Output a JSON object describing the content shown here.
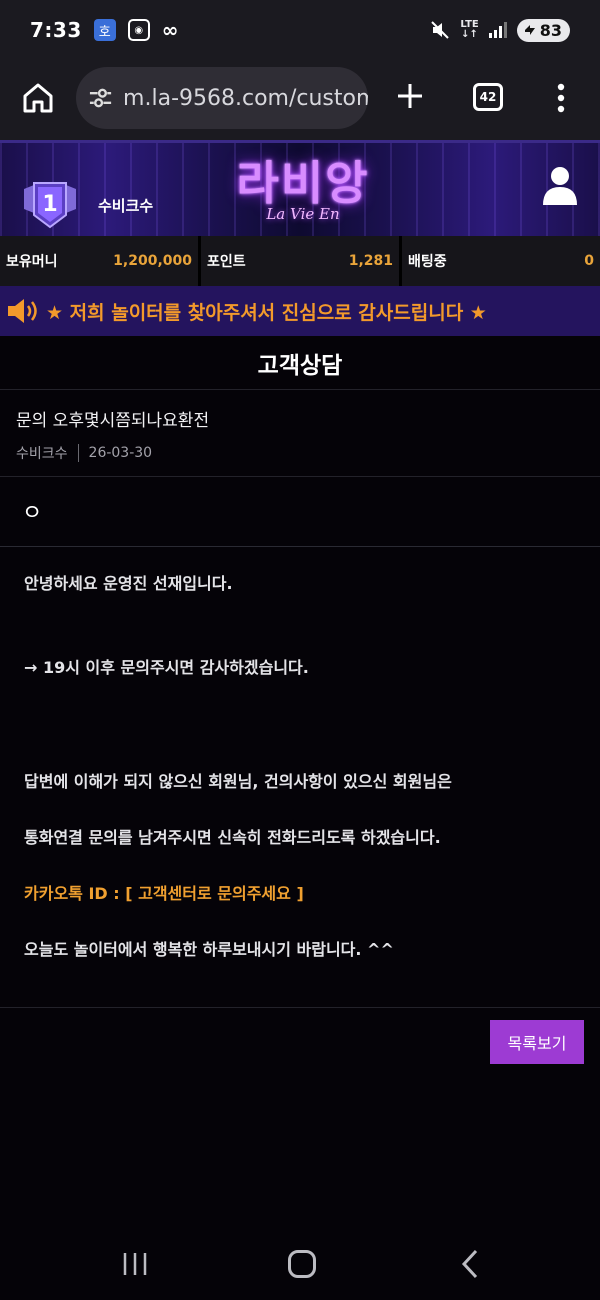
{
  "status_bar": {
    "time": "7:33",
    "app_icon_text": "호",
    "lte_label": "LTE",
    "battery_level": "83"
  },
  "browser": {
    "url": "m.la-9568.com/custom",
    "tab_count": "42"
  },
  "banner": {
    "rank_number": "1",
    "username": "수비크수",
    "logo_text": "라비앙",
    "logo_subtext": "La Vie En"
  },
  "stats": [
    {
      "label": "보유머니",
      "value": "1,200,000"
    },
    {
      "label": "포인트",
      "value": "1,281"
    },
    {
      "label": "배팅중",
      "value": "0"
    }
  ],
  "notice": {
    "text": "★ 저희 놀이터를 찾아주셔서 진심으로 감사드립니다 ★"
  },
  "page": {
    "title": "고객상담"
  },
  "post": {
    "title": "문의 오후몇시쯤되나요환전",
    "author": "수비크수",
    "date": "26-03-30",
    "question_body": "ㅇ"
  },
  "answer": {
    "lines": [
      "안녕하세요 운영진 선재입니다.",
      "→ 19시 이후 문의주시면 감사하겠습니다.",
      "답변에 이해가 되지 않으신 회원님, 건의사항이 있으신 회원님은",
      "통화연결 문의를 남겨주시면 신속히 전화드리도록 하겠습니다.",
      "카카오톡 ID : [ 고객센터로 문의주세요 ]",
      "오늘도 놀이터에서 행복한 하루보내시기 바랍니다. ^^"
    ]
  },
  "actions": {
    "list_button_label": "목록보기"
  },
  "colors": {
    "accent_orange": "#f0a030",
    "button_purple": "#9d3bd3",
    "notice_bg": "#24145e",
    "logo_neon": "#d88cff"
  },
  "icons": {
    "home": "home-icon",
    "site_settings": "tune-icon",
    "new_tab": "plus-icon",
    "tabs": "tab-switcher-icon",
    "menu": "more-vert-icon",
    "profile": "person-icon",
    "notice": "speaker-icon",
    "nav_recents": "recents-icon",
    "nav_home": "home-circle-icon",
    "nav_back": "back-chevron-icon"
  }
}
